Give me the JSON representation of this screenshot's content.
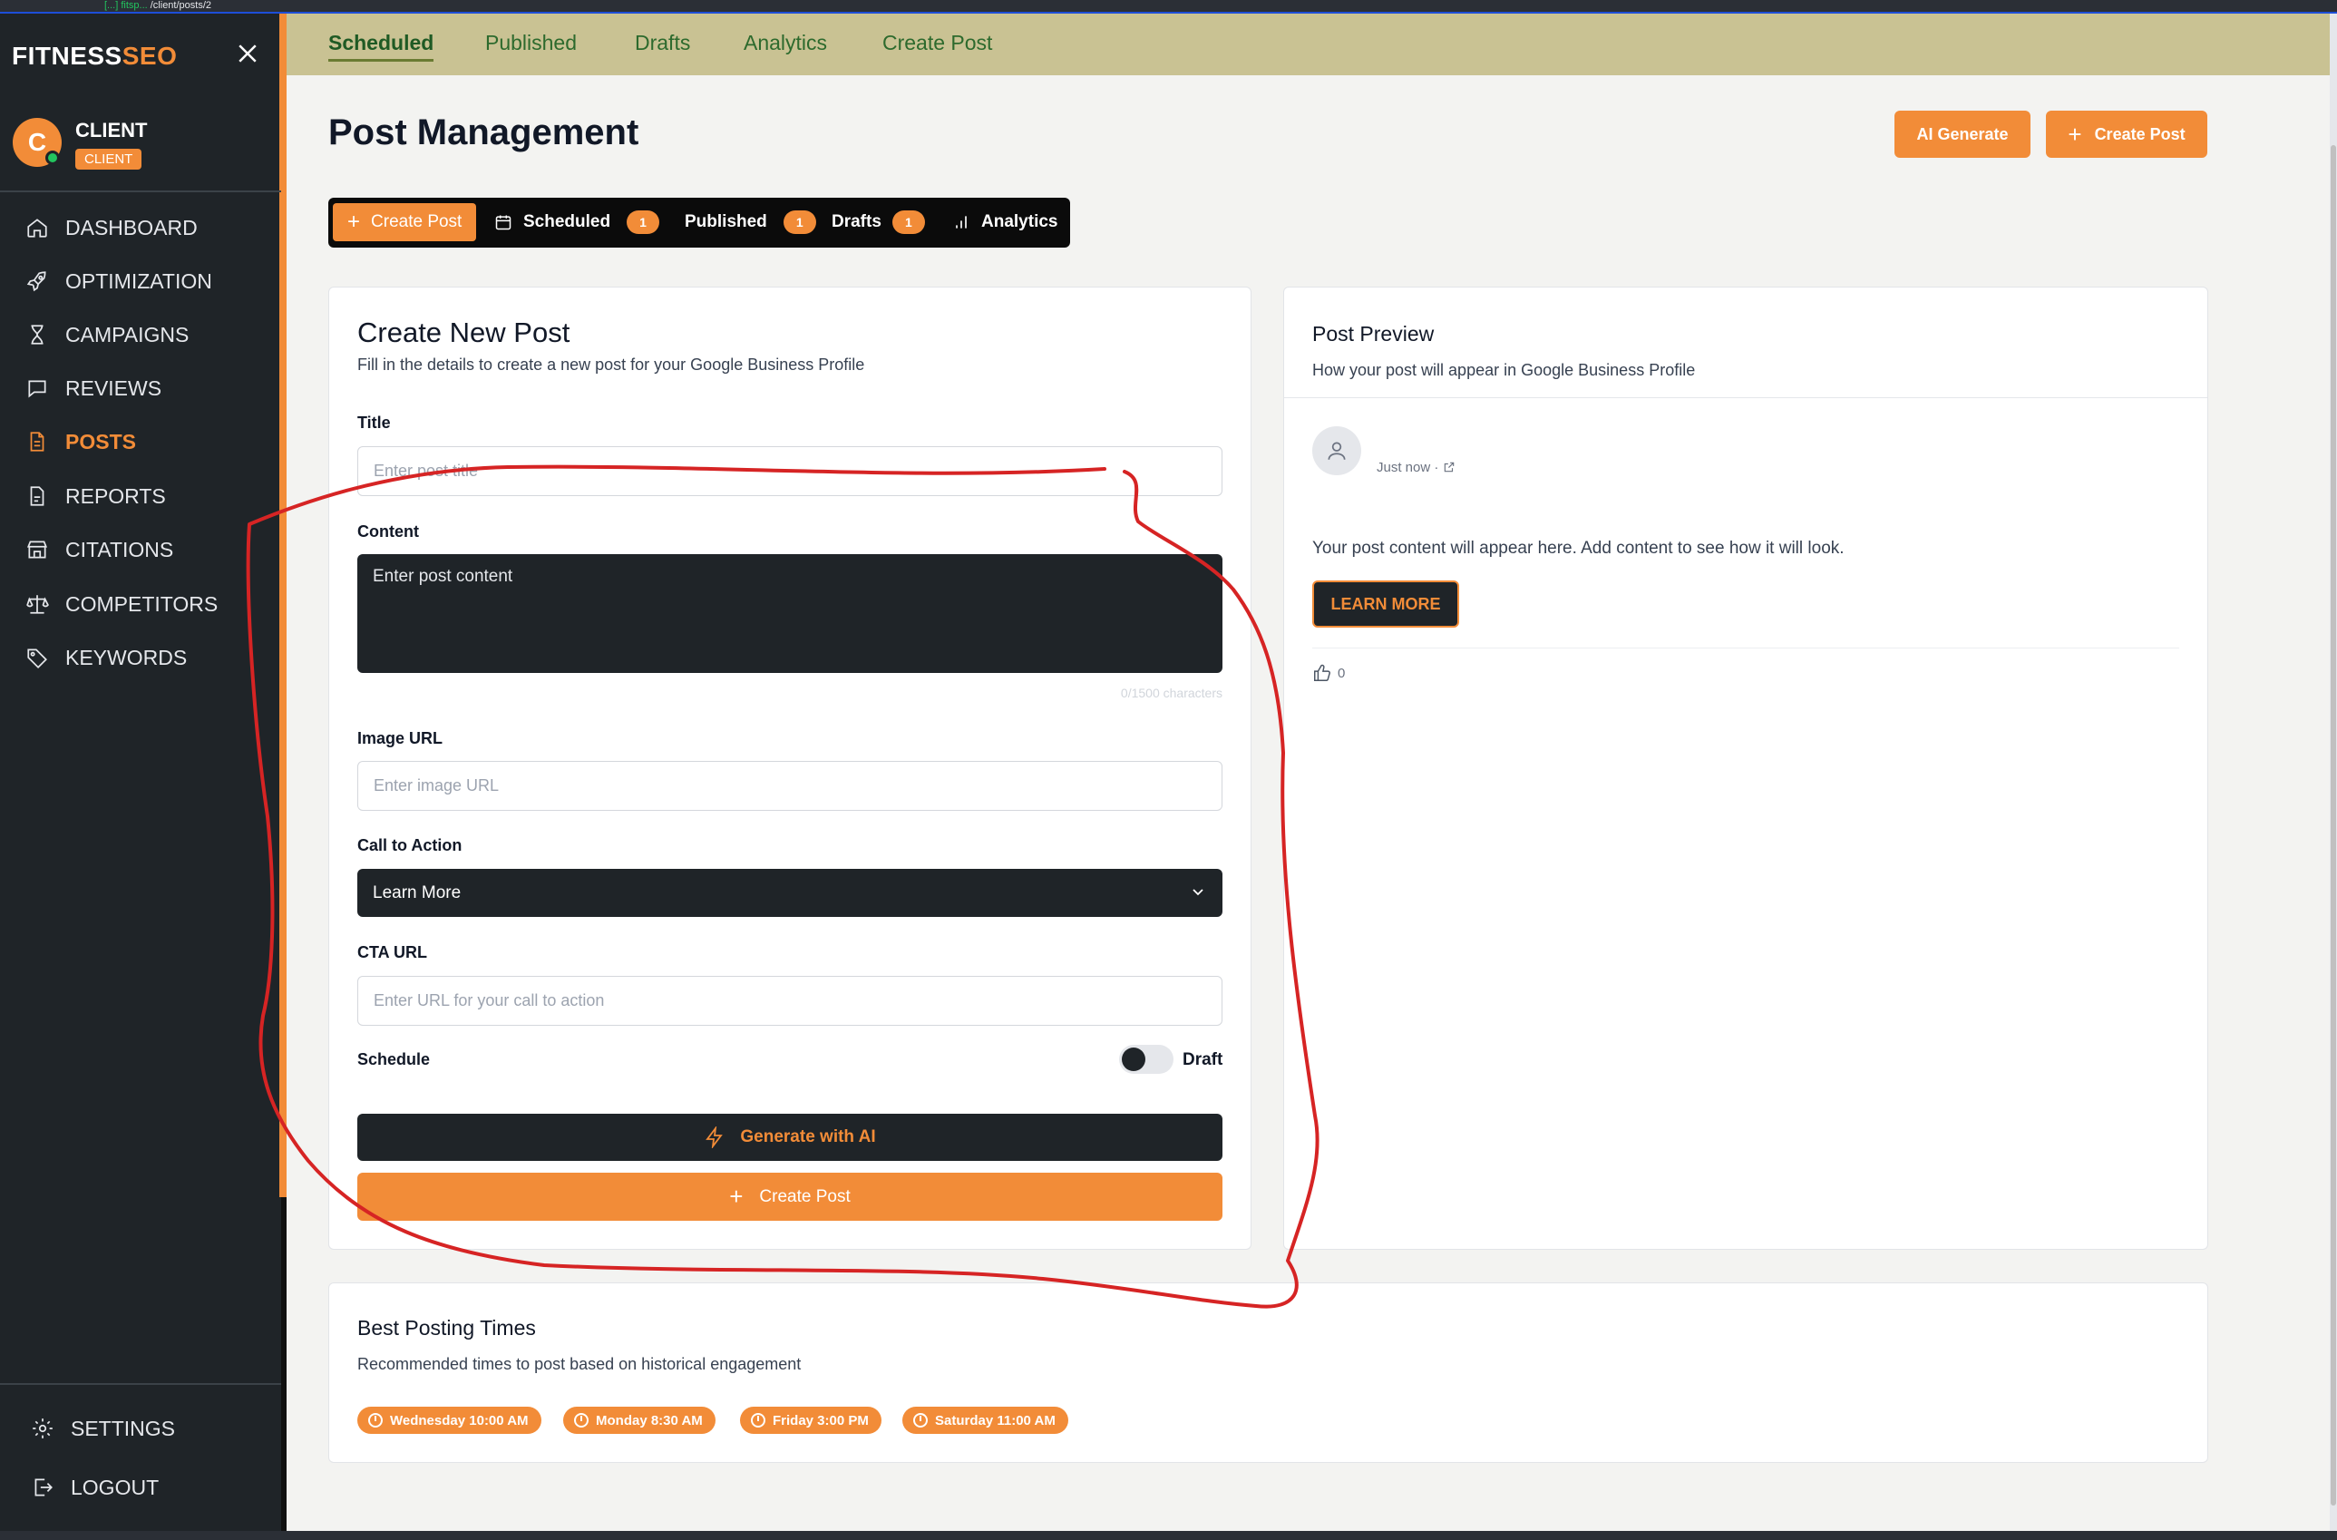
{
  "browser": {
    "url_prefix": "[...] fitsp...",
    "url_path": "/client/posts/2"
  },
  "sidebar": {
    "brand_main": "FITNESS",
    "brand_accent": "SEO",
    "user": {
      "initial": "C",
      "name": "CLIENT",
      "role": "CLIENT"
    },
    "items": [
      {
        "label": "DASHBOARD",
        "icon": "home-icon"
      },
      {
        "label": "OPTIMIZATION",
        "icon": "rocket-icon"
      },
      {
        "label": "CAMPAIGNS",
        "icon": "hourglass-icon"
      },
      {
        "label": "REVIEWS",
        "icon": "message-icon"
      },
      {
        "label": "POSTS",
        "icon": "document-icon",
        "active": true
      },
      {
        "label": "REPORTS",
        "icon": "report-icon"
      },
      {
        "label": "CITATIONS",
        "icon": "store-icon"
      },
      {
        "label": "COMPETITORS",
        "icon": "scale-icon"
      },
      {
        "label": "KEYWORDS",
        "icon": "tag-icon"
      }
    ],
    "settings_label": "SETTINGS",
    "logout_label": "LOGOUT"
  },
  "topbar": {
    "tabs": [
      {
        "label": "Scheduled",
        "active": true
      },
      {
        "label": "Published"
      },
      {
        "label": "Drafts"
      },
      {
        "label": "Analytics"
      },
      {
        "label": "Create Post"
      }
    ]
  },
  "header": {
    "title": "Post Management",
    "ai_generate_label": "AI Generate",
    "create_post_label": "Create Post"
  },
  "segmented": {
    "create_label": "Create Post",
    "scheduled_label": "Scheduled",
    "scheduled_count": "1",
    "published_label": "Published",
    "published_count": "1",
    "drafts_label": "Drafts",
    "drafts_count": "1",
    "analytics_label": "Analytics"
  },
  "form": {
    "title": "Create New Post",
    "subtitle": "Fill in the details to create a new post for your Google Business Profile",
    "title_label": "Title",
    "title_placeholder": "Enter post title",
    "content_label": "Content",
    "content_placeholder": "Enter post content",
    "char_count": "0/1500 characters",
    "image_label": "Image URL",
    "image_placeholder": "Enter image URL",
    "cta_label": "Call to Action",
    "cta_selected": "Learn More",
    "cta_url_label": "CTA URL",
    "cta_url_placeholder": "Enter URL for your call to action",
    "schedule_label": "Schedule",
    "toggle_label": "Draft",
    "ai_button_label": "Generate with AI",
    "create_button_label": "Create Post"
  },
  "preview": {
    "title": "Post Preview",
    "subtitle": "How your post will appear in Google Business Profile",
    "time": "Just now ·",
    "content": "Your post content will appear here. Add content to see how it will look.",
    "cta_button": "LEARN MORE",
    "likes": "0"
  },
  "best_times": {
    "title": "Best Posting Times",
    "subtitle": "Recommended times to post based on historical engagement",
    "chips": [
      "Wednesday 10:00 AM",
      "Monday 8:30 AM",
      "Friday 3:00 PM",
      "Saturday 11:00 AM"
    ]
  },
  "colors": {
    "accent": "#f28c38",
    "sidebar_bg": "#1f2428",
    "topbar_bg": "#c9c293",
    "annotation": "#d62424"
  }
}
